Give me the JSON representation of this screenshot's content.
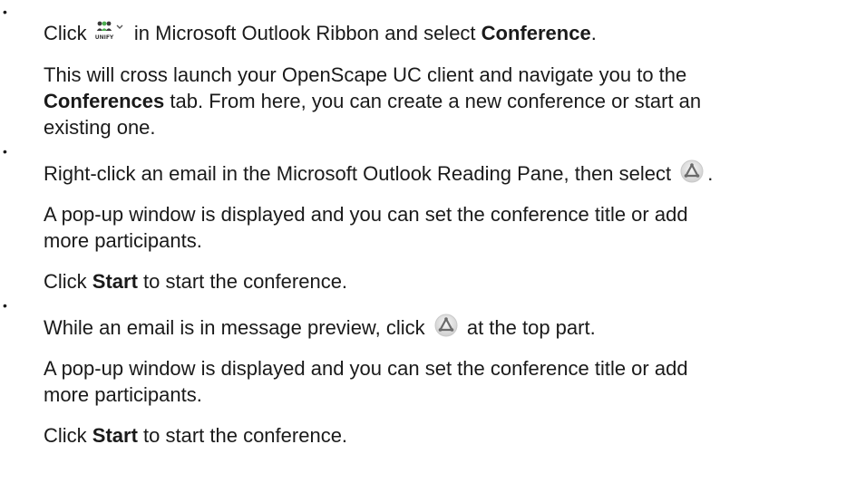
{
  "steps": [
    {
      "lead_before": "Click",
      "lead_icon": "unify-ribbon-icon",
      "lead_icon_text": "UNIFY",
      "lead_after": " in Microsoft Outlook Ribbon and select ",
      "lead_bold": "Conference",
      "lead_end": ".",
      "para1_before": "This will cross launch your OpenScape UC client and navigate you to the ",
      "para1_bold": "Conferences",
      "para1_after": " tab. From here, you can create a new conference or start an existing one."
    },
    {
      "lead_before": "Right-click an email in the Microsoft Outlook Reading Pane, then select ",
      "lead_icon": "conference-icon",
      "lead_end": ".",
      "para1": "A pop-up window is displayed and you can set the conference title or add more participants.",
      "para2_before": "Click ",
      "para2_bold": "Start",
      "para2_after": " to start the conference."
    },
    {
      "lead_before": "While an email is in message preview, click ",
      "lead_icon": "conference-icon",
      "lead_after": " at the top part.",
      "para1": "A pop-up window is displayed and you can set the conference title or add more participants.",
      "para2_before": "Click ",
      "para2_bold": "Start",
      "para2_after": " to start the conference."
    }
  ],
  "bullet_glyph": "•",
  "colors": {
    "text": "#1a1a1a",
    "unify_green": "#4caf50",
    "unify_dark": "#3a3a3a",
    "conf_ring": "#c9c9c9",
    "conf_symbol": "#6a6a6a"
  }
}
